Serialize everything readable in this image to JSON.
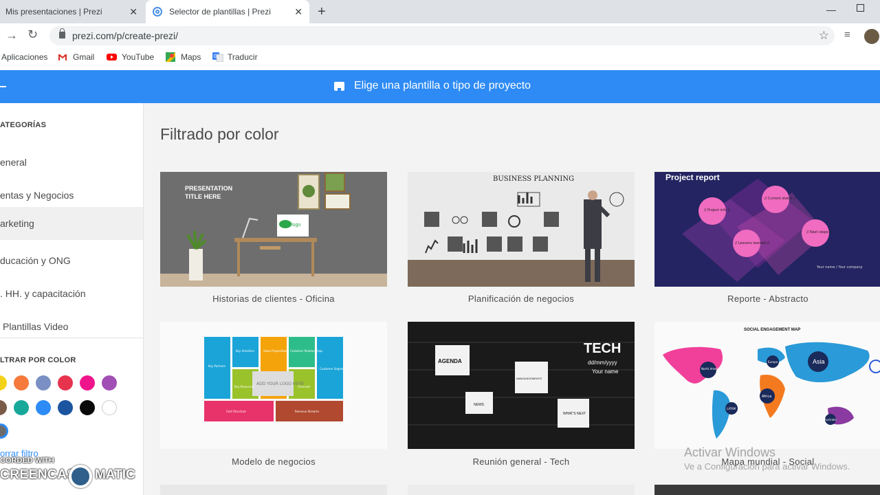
{
  "browser": {
    "tabs": [
      {
        "title": "Mis presentaciones | Prezi",
        "active": false
      },
      {
        "title": "Selector de plantillas | Prezi",
        "active": true
      }
    ],
    "url": "prezi.com/p/create-prezi/",
    "bookmarks": [
      {
        "label": "Aplicaciones",
        "icon": "apps-grid-icon"
      },
      {
        "label": "Gmail",
        "icon": "gmail-icon"
      },
      {
        "label": "YouTube",
        "icon": "youtube-icon"
      },
      {
        "label": "Maps",
        "icon": "maps-icon"
      },
      {
        "label": "Traducir",
        "icon": "translate-icon"
      }
    ]
  },
  "header": {
    "title": "Elige una plantilla o tipo de proyecto"
  },
  "sidebar": {
    "categories_heading": "ATEGORÍAS",
    "categories": [
      {
        "label": "eneral",
        "selected": false
      },
      {
        "label": "entas y Negocios",
        "selected": false
      },
      {
        "label": "arketing",
        "selected": true
      },
      {
        "label": "ducación y ONG",
        "selected": false
      },
      {
        "label": ". HH. y capacitación",
        "selected": false
      },
      {
        "label": "Plantillas Video",
        "selected": false
      }
    ],
    "filter_heading": "LTRAR POR COLOR",
    "colors": [
      "#f5d21a",
      "#f57a3c",
      "#7a90c4",
      "#e8334e",
      "#f0148c",
      "#a24fb5",
      "#7a5a48",
      "#17a89a",
      "#2e8bf5",
      "#1b55a0",
      "#0a0a0a",
      "#ffffff",
      "#6b6b6b"
    ],
    "clear_filter": "orrar filtro",
    "watermark_top": "CORDED WITH",
    "watermark_left": "CREENCAST",
    "watermark_right": "MATIC"
  },
  "main": {
    "title": "Filtrado por color",
    "templates": [
      {
        "label": "Historias de clientes - Oficina",
        "thumb_text": [
          "PRESENTATION",
          "TITLE HERE",
          "logo"
        ]
      },
      {
        "label": "Planificación de negocios",
        "thumb_text": [
          "BUSINESS PLANNING"
        ]
      },
      {
        "label": "Reporte - Abstracto",
        "thumb_text": [
          "Project report",
          "// Project info //",
          "// Current status //",
          "// Lessons learned //",
          "// Next steps //",
          "Your name / Your company"
        ]
      },
      {
        "label": "Modelo de negocios",
        "thumb_text": [
          "Key Partners",
          "Key Activities",
          "Value Propositions",
          "Customer Relationships",
          "Customer Segments",
          "Key Resources",
          "Channels",
          "Cost Structure",
          "Revenue Streams",
          "ADD YOUR LOGO HERE"
        ]
      },
      {
        "label": "Reunión general - Tech",
        "thumb_text": [
          "TECH",
          "dd/mm/yyyy",
          "Your name",
          "AGENDA",
          "ANNOUNCEMENTS",
          "NEWS",
          "WHAT'S NEXT"
        ]
      },
      {
        "label": "Mapa mundial - Social",
        "thumb_text": [
          "SOCIAL ENGAGEMENT MAP",
          "Asia",
          "North America",
          "Europe",
          "Africa",
          "LATAM",
          "Australia"
        ]
      }
    ]
  },
  "os_notice": {
    "line1": "Activar Windows",
    "line2": "Ve a Configuración para activar Windows."
  }
}
